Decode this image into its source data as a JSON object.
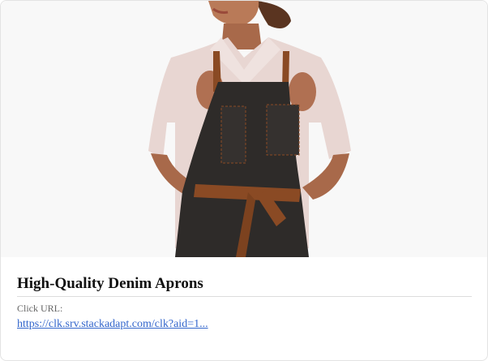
{
  "card": {
    "image_alt": "Woman wearing a dark denim apron with brown straps",
    "title": "High-Quality Denim Aprons",
    "click_url_label": "Click URL:",
    "click_url": "https://clk.srv.stackadapt.com/clk?aid=1..."
  },
  "colors": {
    "link": "#3366cc",
    "apron": "#2e2b29",
    "strap": "#8a4a24",
    "shirt": "#e8d6d2"
  }
}
